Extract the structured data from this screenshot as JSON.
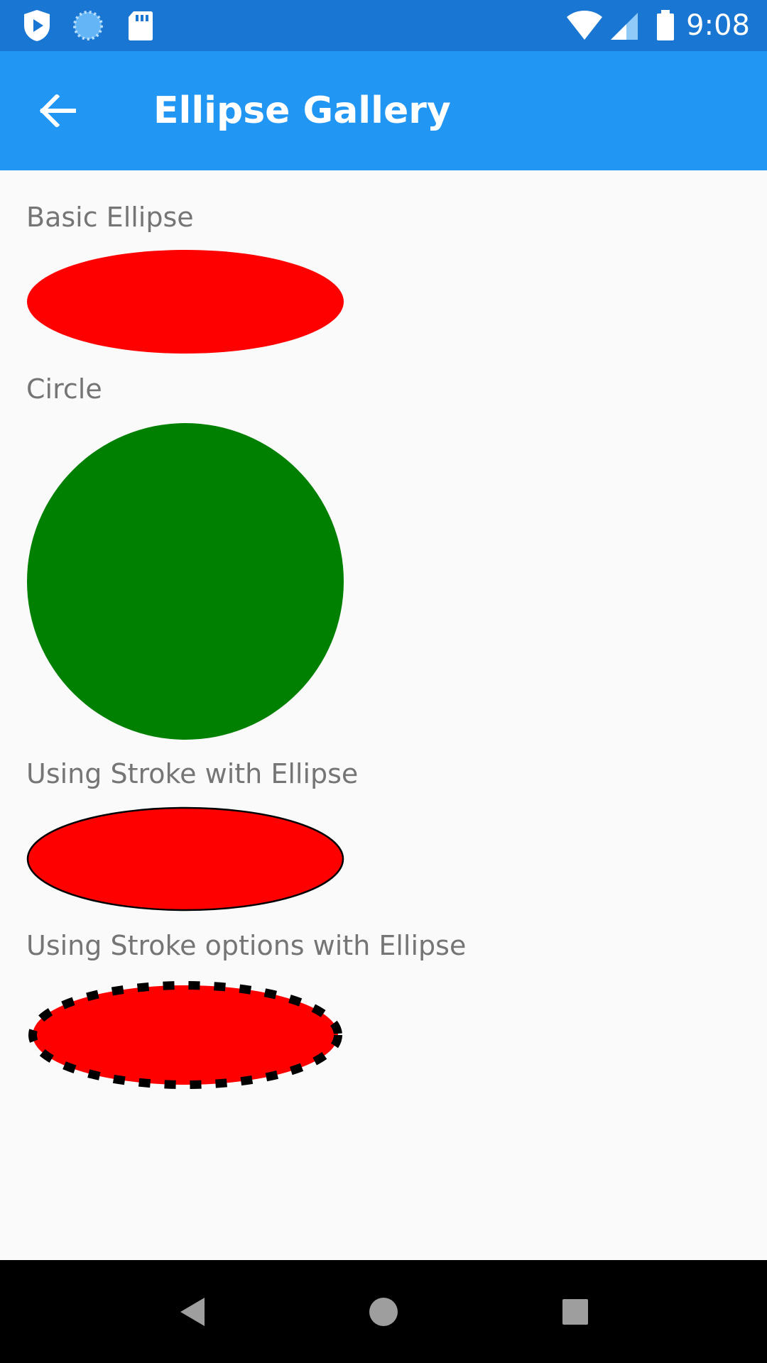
{
  "status_bar": {
    "time": "9:08",
    "left_icons": [
      "play-protect-shield-icon",
      "sync-spinner-icon",
      "sd-card-icon"
    ],
    "right_icons": [
      "wifi-icon",
      "cell-signal-icon",
      "battery-icon"
    ],
    "color": "#1976d2"
  },
  "app_bar": {
    "title": "Ellipse Gallery",
    "back_icon": "arrow-back-icon",
    "color": "#2196f3"
  },
  "sections": [
    {
      "label": "Basic Ellipse",
      "fill": "#ff0000",
      "stroke": "none"
    },
    {
      "label": "Circle",
      "fill": "#008000",
      "stroke": "none"
    },
    {
      "label": "Using Stroke with Ellipse",
      "fill": "#ff0000",
      "stroke": "#000000",
      "stroke_style": "solid"
    },
    {
      "label": "Using Stroke options with Ellipse",
      "fill": "#ff0000",
      "stroke": "#000000",
      "stroke_style": "dashed"
    }
  ],
  "nav_bar": {
    "buttons": [
      "back-triangle-icon",
      "home-circle-icon",
      "recents-square-icon"
    ]
  }
}
